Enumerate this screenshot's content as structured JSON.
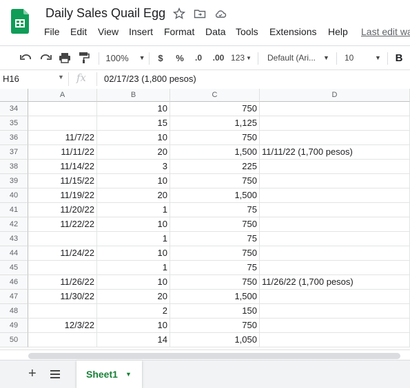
{
  "app": {
    "doc_title": "Daily Sales Quail Egg",
    "menus": [
      "File",
      "Edit",
      "View",
      "Insert",
      "Format",
      "Data",
      "Tools",
      "Extensions",
      "Help"
    ],
    "last_edit": "Last edit wa"
  },
  "toolbar": {
    "zoom": "100%",
    "currency": "$",
    "percent": "%",
    "dec_decrease": ".0",
    "dec_increase": ".00",
    "more_formats": "123",
    "font": "Default (Ari...",
    "font_size": "10",
    "bold": "B"
  },
  "formula_bar": {
    "cell_ref": "H16",
    "fx": "fx",
    "content": "02/17/23 (1,800 pesos)"
  },
  "columns": [
    "A",
    "B",
    "C",
    "D"
  ],
  "rows": [
    {
      "num": "34",
      "a": "",
      "b": "10",
      "c": "750",
      "d": ""
    },
    {
      "num": "35",
      "a": "",
      "b": "15",
      "c": "1,125",
      "d": ""
    },
    {
      "num": "36",
      "a": "11/7/22",
      "b": "10",
      "c": "750",
      "d": ""
    },
    {
      "num": "37",
      "a": "11/11/22",
      "b": "20",
      "c": "1,500",
      "d": "11/11/22 (1,700 pesos)"
    },
    {
      "num": "38",
      "a": "11/14/22",
      "b": "3",
      "c": "225",
      "d": ""
    },
    {
      "num": "39",
      "a": "11/15/22",
      "b": "10",
      "c": "750",
      "d": ""
    },
    {
      "num": "40",
      "a": "11/19/22",
      "b": "20",
      "c": "1,500",
      "d": ""
    },
    {
      "num": "41",
      "a": "11/20/22",
      "b": "1",
      "c": "75",
      "d": ""
    },
    {
      "num": "42",
      "a": "11/22/22",
      "b": "10",
      "c": "750",
      "d": ""
    },
    {
      "num": "43",
      "a": "",
      "b": "1",
      "c": "75",
      "d": ""
    },
    {
      "num": "44",
      "a": "11/24/22",
      "b": "10",
      "c": "750",
      "d": ""
    },
    {
      "num": "45",
      "a": "",
      "b": "1",
      "c": "75",
      "d": ""
    },
    {
      "num": "46",
      "a": "11/26/22",
      "b": "10",
      "c": "750",
      "d": "11/26/22 (1,700 pesos)"
    },
    {
      "num": "47",
      "a": "11/30/22",
      "b": "20",
      "c": "1,500",
      "d": ""
    },
    {
      "num": "48",
      "a": "",
      "b": "2",
      "c": "150",
      "d": ""
    },
    {
      "num": "49",
      "a": "12/3/22",
      "b": "10",
      "c": "750",
      "d": ""
    },
    {
      "num": "50",
      "a": "",
      "b": "14",
      "c": "1,050",
      "d": ""
    }
  ],
  "sheets": {
    "add": "+",
    "active_sheet": "Sheet1"
  },
  "colors": {
    "brand_green": "#188038",
    "header_bg": "#f8f9fa"
  }
}
